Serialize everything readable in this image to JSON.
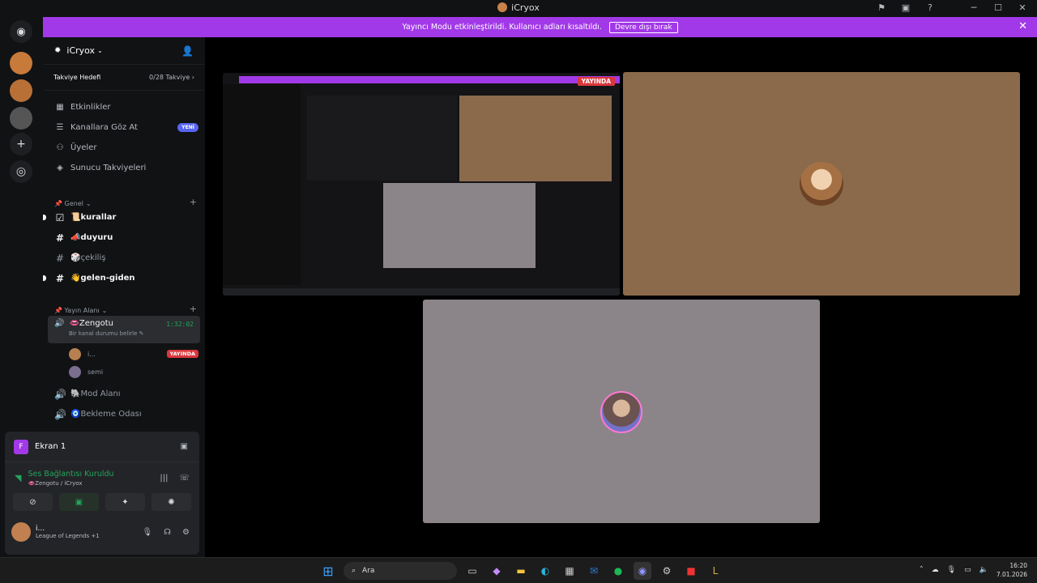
{
  "window": {
    "title": "iCryox"
  },
  "banner": {
    "message": "Yayıncı Modu etkinleştirildi. Kullanıcı adları kısaltıldı.",
    "button": "Devre dışı bırak"
  },
  "server": {
    "name": "iCryox",
    "boost_label": "Takviye Hedefi",
    "boost_count": "0/28 Takviye",
    "menu": [
      {
        "label": "Etkinlikler",
        "icon": "calendar-icon"
      },
      {
        "label": "Kanallara Göz At",
        "icon": "browse-icon",
        "badge": "YENİ"
      },
      {
        "label": "Üyeler",
        "icon": "members-icon"
      },
      {
        "label": "Sunucu Takviyeleri",
        "icon": "boost-icon"
      }
    ],
    "categories": [
      {
        "name": "📌 Genel",
        "channels": [
          {
            "name": "📜kurallar",
            "icon": "rules-icon"
          },
          {
            "name": "📣duyuru",
            "icon": "hash-icon"
          },
          {
            "name": "🎲çekiliş",
            "icon": "hash-icon"
          },
          {
            "name": "👋gelen-giden",
            "icon": "hash-icon"
          }
        ]
      },
      {
        "name": "📌 Yayın Alanı",
        "voice": {
          "name": "👄Zengotu",
          "status": "Bir kanal durumu belirle",
          "time": "1:32:02",
          "users": [
            {
              "name": "i...",
              "live": "YAYINDA"
            },
            {
              "name": "semi"
            }
          ]
        },
        "channels": [
          {
            "name": "🐘Mod Alanı",
            "icon": "speaker-icon"
          },
          {
            "name": "🧿Bekleme Odası",
            "icon": "speaker-icon"
          }
        ]
      }
    ]
  },
  "panel": {
    "screen": "Ekran 1",
    "screen_icon_letter": "F",
    "connection": "Ses Bağlantısı Kuruldu",
    "connection_sub": "👄Zengotu / iCryox",
    "user_name": "i...",
    "user_game": "League of Legends +1"
  },
  "stage": {
    "live": "YAYINDA"
  },
  "taskbar": {
    "search": "Ara",
    "time": "16:20",
    "date": "7.01.2026"
  },
  "colors": {
    "accent": "#a239e8",
    "live": "#da373c",
    "online": "#23a55a",
    "brand": "#5865f2"
  }
}
